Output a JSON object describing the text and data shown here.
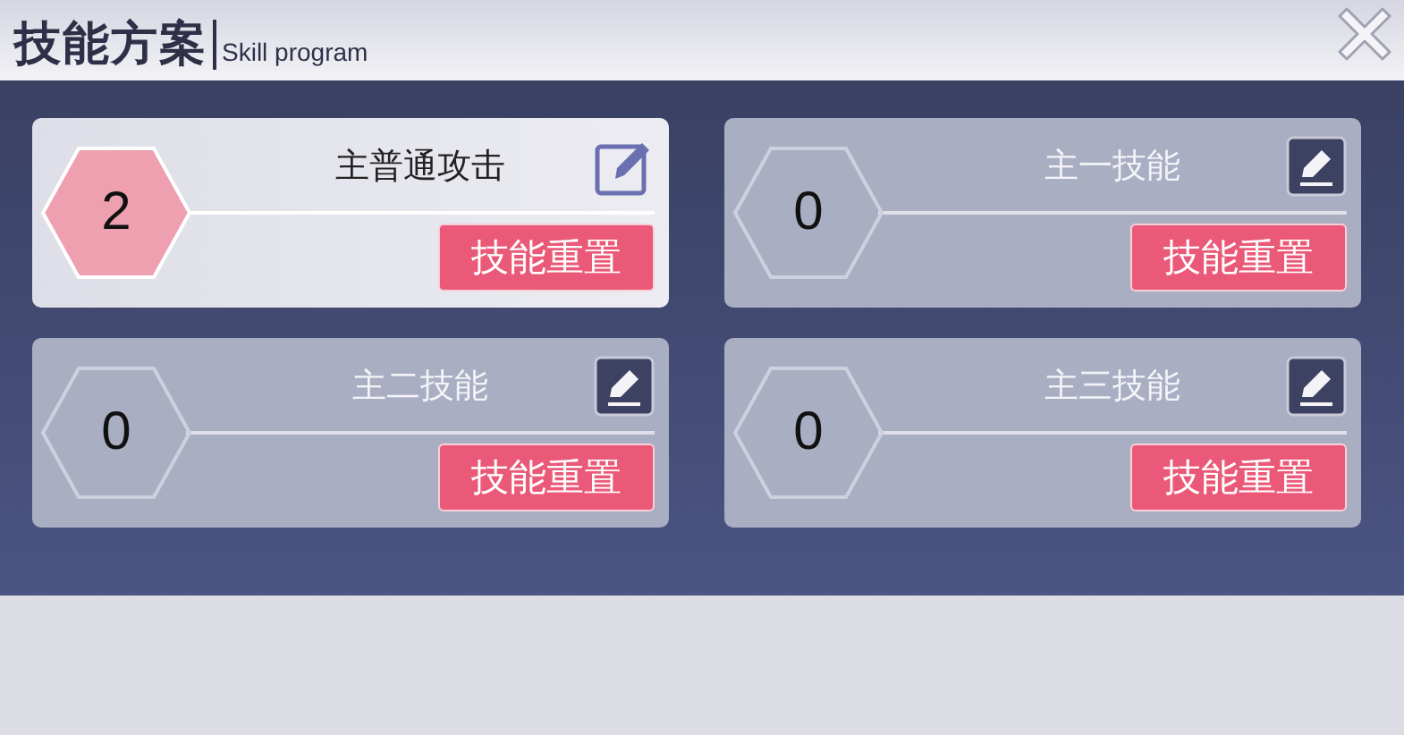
{
  "window": {
    "title": "技能方案",
    "subtitle": "Skill program"
  },
  "skills": [
    {
      "name": "主普通攻击",
      "points": "2",
      "selected": true,
      "reset_label": "技能重置"
    },
    {
      "name": "主一技能",
      "points": "0",
      "selected": false,
      "reset_label": "技能重置"
    },
    {
      "name": "主二技能",
      "points": "0",
      "selected": false,
      "reset_label": "技能重置"
    },
    {
      "name": "主三技能",
      "points": "0",
      "selected": false,
      "reset_label": "技能重置"
    }
  ]
}
